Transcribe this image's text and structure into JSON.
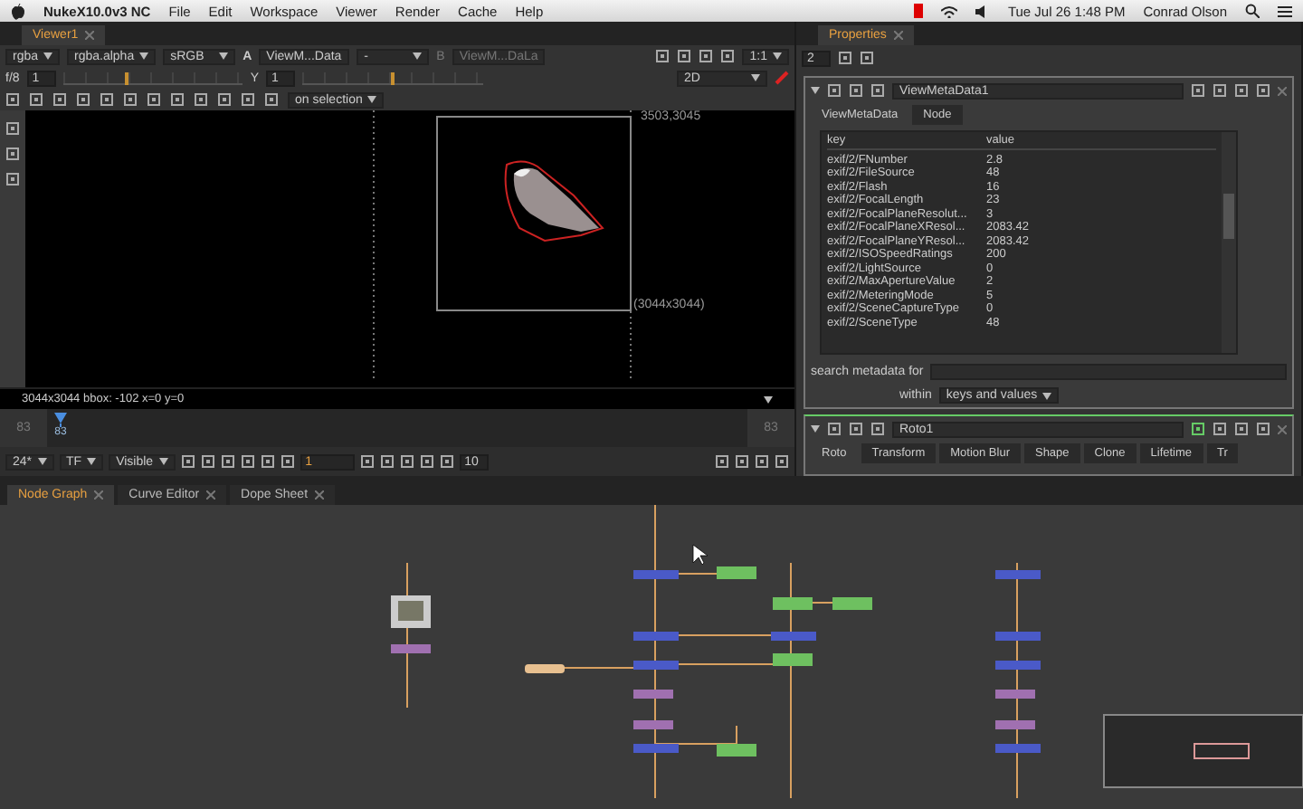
{
  "menu_bar": {
    "app": "NukeX10.0v3 NC",
    "menus": [
      "File",
      "Edit",
      "Workspace",
      "Viewer",
      "Render",
      "Cache",
      "Help"
    ],
    "clock": "Tue Jul 26 1:48 PM",
    "user": "Conrad Olson"
  },
  "viewer": {
    "tab": "Viewer1",
    "channels": "rgba",
    "alpha": "rgba.alpha",
    "colorspace": "sRGB",
    "input_a_label": "A",
    "input_a": "ViewM...Data",
    "wipe": "-",
    "input_b_label": "B",
    "input_b": "ViewM...DaLa",
    "zoom": "1:1",
    "fstop": "f/8",
    "gain": "1",
    "gain_slider": {
      "level": 0.35
    },
    "gamma_slider": {
      "level": 0.5
    },
    "gamma_label": "Y",
    "gamma": "1",
    "view_mode": "2D",
    "roto_mode": "on selection",
    "corner_label": "3503,3045",
    "format_label": "(3044x3044)",
    "status": "3044x3044 bbox: -102 x=0 y=0"
  },
  "timeline": {
    "start": "83",
    "current": "83",
    "end": "83",
    "fps": "24*",
    "mode": "TF",
    "range": "Visible",
    "frame": "1",
    "step": "10"
  },
  "graph_tabs": [
    {
      "label": "Node Graph",
      "selected": true
    },
    {
      "label": "Curve Editor",
      "selected": false
    },
    {
      "label": "Dope Sheet",
      "selected": false
    }
  ],
  "properties": {
    "tab": "Properties",
    "max_panels": "2",
    "node": {
      "name": "ViewMetaData1",
      "tabs": [
        {
          "label": "ViewMetaData",
          "selected": true
        },
        {
          "label": "Node",
          "selected": false
        }
      ],
      "columns": [
        "key",
        "value"
      ],
      "rows": [
        [
          "exif/2/FNumber",
          "2.8"
        ],
        [
          "exif/2/FileSource",
          "48"
        ],
        [
          "exif/2/Flash",
          "16"
        ],
        [
          "exif/2/FocalLength",
          "23"
        ],
        [
          "exif/2/FocalPlaneResolut...",
          "3"
        ],
        [
          "exif/2/FocalPlaneXResol...",
          "2083.42"
        ],
        [
          "exif/2/FocalPlaneYResol...",
          "2083.42"
        ],
        [
          "exif/2/ISOSpeedRatings",
          "200"
        ],
        [
          "exif/2/LightSource",
          "0"
        ],
        [
          "exif/2/MaxApertureValue",
          "2"
        ],
        [
          "exif/2/MeteringMode",
          "5"
        ],
        [
          "exif/2/SceneCaptureType",
          "0"
        ],
        [
          "exif/2/SceneType",
          "48"
        ]
      ],
      "search_label": "search metadata for",
      "within_label": "within",
      "within": "keys and values"
    },
    "roto": {
      "name": "Roto1",
      "tabs": [
        {
          "label": "Roto",
          "selected": true
        },
        {
          "label": "Transform",
          "selected": false
        },
        {
          "label": "Motion Blur",
          "selected": false
        },
        {
          "label": "Shape",
          "selected": false
        },
        {
          "label": "Clone",
          "selected": false
        },
        {
          "label": "Lifetime",
          "selected": false
        },
        {
          "label": "Tr",
          "selected": false
        }
      ]
    }
  }
}
